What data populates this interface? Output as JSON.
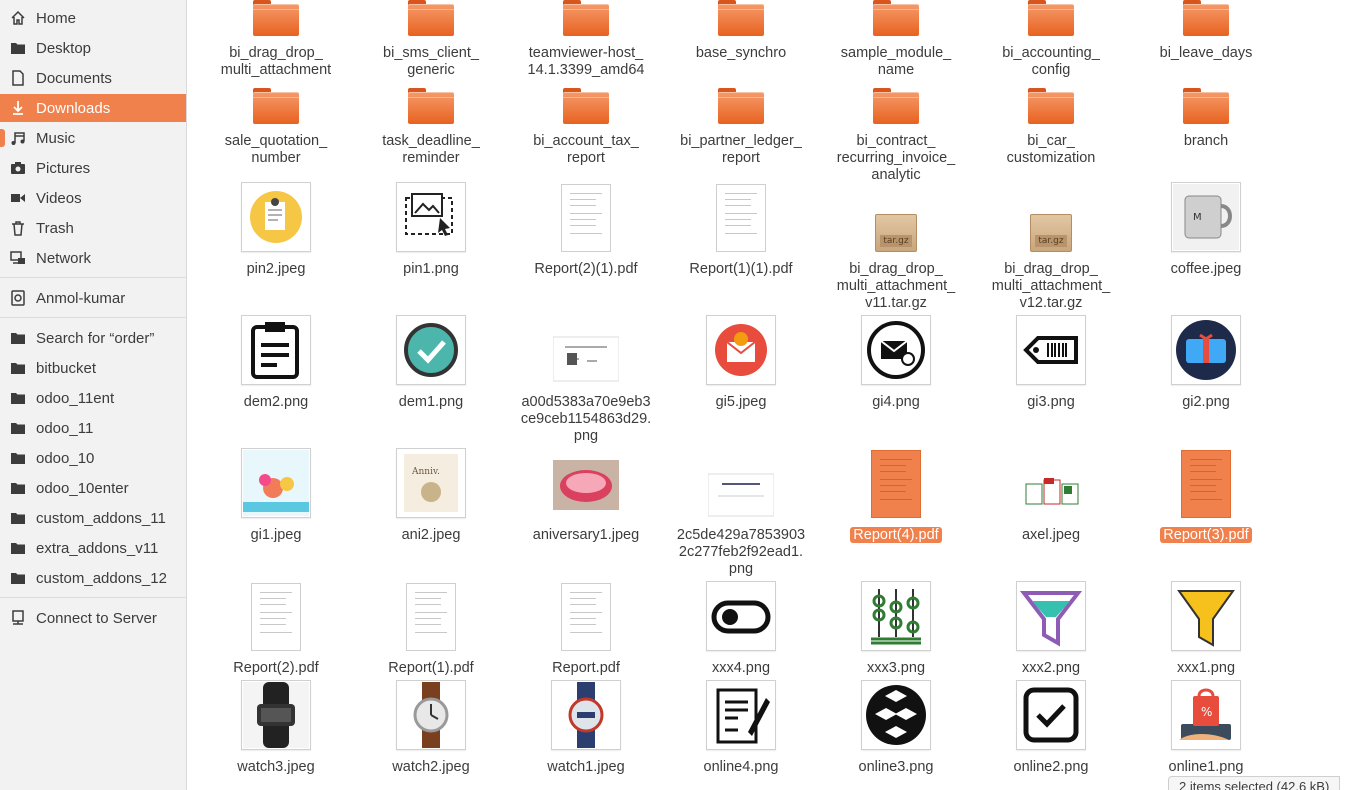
{
  "sidebar": {
    "items": [
      {
        "label": "Home",
        "icon": "home-icon"
      },
      {
        "label": "Desktop",
        "icon": "folder-icon"
      },
      {
        "label": "Documents",
        "icon": "document-icon"
      },
      {
        "label": "Downloads",
        "icon": "download-icon",
        "active": true
      },
      {
        "label": "Music",
        "icon": "music-icon"
      },
      {
        "label": "Pictures",
        "icon": "camera-icon"
      },
      {
        "label": "Videos",
        "icon": "video-icon"
      },
      {
        "label": "Trash",
        "icon": "trash-icon"
      },
      {
        "label": "Network",
        "icon": "network-icon"
      },
      {
        "label": "Anmol-kumar",
        "icon": "drive-icon"
      },
      {
        "label": "Search for “order”",
        "icon": "folder-icon"
      },
      {
        "label": "bitbucket",
        "icon": "folder-icon"
      },
      {
        "label": "odoo_11ent",
        "icon": "folder-icon"
      },
      {
        "label": "odoo_11",
        "icon": "folder-icon"
      },
      {
        "label": "odoo_10",
        "icon": "folder-icon"
      },
      {
        "label": "odoo_10enter",
        "icon": "folder-icon"
      },
      {
        "label": "custom_addons_11",
        "icon": "folder-icon"
      },
      {
        "label": "extra_addons_v11",
        "icon": "folder-icon"
      },
      {
        "label": "custom_addons_12",
        "icon": "folder-icon"
      },
      {
        "label": "Connect to Server",
        "icon": "server-icon"
      }
    ]
  },
  "files": [
    {
      "name": "bi_drag_drop_\nmulti_attachment",
      "kind": "folder"
    },
    {
      "name": "bi_sms_client_\ngeneric",
      "kind": "folder"
    },
    {
      "name": "teamviewer-host_\n14.1.3399_amd64",
      "kind": "folder"
    },
    {
      "name": "base_synchro",
      "kind": "folder"
    },
    {
      "name": "sample_module_\nname",
      "kind": "folder"
    },
    {
      "name": "bi_accounting_\nconfig",
      "kind": "folder"
    },
    {
      "name": "bi_leave_days",
      "kind": "folder"
    },
    {
      "name": "sale_quotation_\nnumber",
      "kind": "folder"
    },
    {
      "name": "task_deadline_\nreminder",
      "kind": "folder"
    },
    {
      "name": "bi_account_tax_\nreport",
      "kind": "folder"
    },
    {
      "name": "bi_partner_ledger_\nreport",
      "kind": "folder"
    },
    {
      "name": "bi_contract_\nrecurring_invoice_\nanalytic",
      "kind": "folder"
    },
    {
      "name": "bi_car_\ncustomization",
      "kind": "folder"
    },
    {
      "name": "branch",
      "kind": "folder"
    },
    {
      "name": "pin2.jpeg",
      "kind": "image",
      "glyph": "pin-note"
    },
    {
      "name": "pin1.png",
      "kind": "image",
      "glyph": "image-cursor"
    },
    {
      "name": "Report(2)(1).pdf",
      "kind": "pdf"
    },
    {
      "name": "Report(1)(1).pdf",
      "kind": "pdf"
    },
    {
      "name": "bi_drag_drop_\nmulti_attachment_\nv11.tar.gz",
      "kind": "tar"
    },
    {
      "name": "bi_drag_drop_\nmulti_attachment_\nv12.tar.gz",
      "kind": "tar"
    },
    {
      "name": "coffee.jpeg",
      "kind": "image",
      "glyph": "mug"
    },
    {
      "name": "dem2.png",
      "kind": "image",
      "glyph": "clipboard"
    },
    {
      "name": "dem1.png",
      "kind": "image",
      "glyph": "check-circle"
    },
    {
      "name": "a00d5383a70e9eb3\nce9ceb1154863d29.\npng",
      "kind": "image",
      "glyph": "doc-small"
    },
    {
      "name": "gi5.jpeg",
      "kind": "image",
      "glyph": "mail-circle"
    },
    {
      "name": "gi4.png",
      "kind": "image",
      "glyph": "envelope-at"
    },
    {
      "name": "gi3.png",
      "kind": "image",
      "glyph": "barcode-tag"
    },
    {
      "name": "gi2.png",
      "kind": "image",
      "glyph": "giftcard"
    },
    {
      "name": "gi1.jpeg",
      "kind": "image",
      "glyph": "flowers"
    },
    {
      "name": "ani2.jpeg",
      "kind": "image",
      "glyph": "anniversary"
    },
    {
      "name": "aniversary1.jpeg",
      "kind": "image",
      "glyph": "cake"
    },
    {
      "name": "2c5de429a7853903\n2c277feb2f92ead1.\npng",
      "kind": "image",
      "glyph": "doc-small2"
    },
    {
      "name": "Report(4).pdf",
      "kind": "pdf",
      "selected": true
    },
    {
      "name": "axel.jpeg",
      "kind": "image",
      "glyph": "office"
    },
    {
      "name": "Report(3).pdf",
      "kind": "pdf",
      "selected": true
    },
    {
      "name": "Report(2).pdf",
      "kind": "pdf"
    },
    {
      "name": "Report(1).pdf",
      "kind": "pdf"
    },
    {
      "name": "Report.pdf",
      "kind": "pdf"
    },
    {
      "name": "xxx4.png",
      "kind": "image",
      "glyph": "toggle"
    },
    {
      "name": "xxx3.png",
      "kind": "image",
      "glyph": "abacus"
    },
    {
      "name": "xxx2.png",
      "kind": "image",
      "glyph": "funnel-outline"
    },
    {
      "name": "xxx1.png",
      "kind": "image",
      "glyph": "funnel-gold"
    },
    {
      "name": "watch3.jpeg",
      "kind": "image",
      "glyph": "band"
    },
    {
      "name": "watch2.jpeg",
      "kind": "image",
      "glyph": "watch-brown"
    },
    {
      "name": "watch1.jpeg",
      "kind": "image",
      "glyph": "watch-blue"
    },
    {
      "name": "online4.png",
      "kind": "image",
      "glyph": "form-pen"
    },
    {
      "name": "online3.png",
      "kind": "image",
      "glyph": "boxes"
    },
    {
      "name": "online2.png",
      "kind": "image",
      "glyph": "checkbox"
    },
    {
      "name": "online1.png",
      "kind": "image",
      "glyph": "shop-bag"
    }
  ],
  "status": {
    "text": "2 items selected  (42.6 kB)"
  },
  "colors": {
    "accent": "#f0804c",
    "sidebar_bg": "#f2f2f2",
    "text": "#3c3c3c"
  }
}
